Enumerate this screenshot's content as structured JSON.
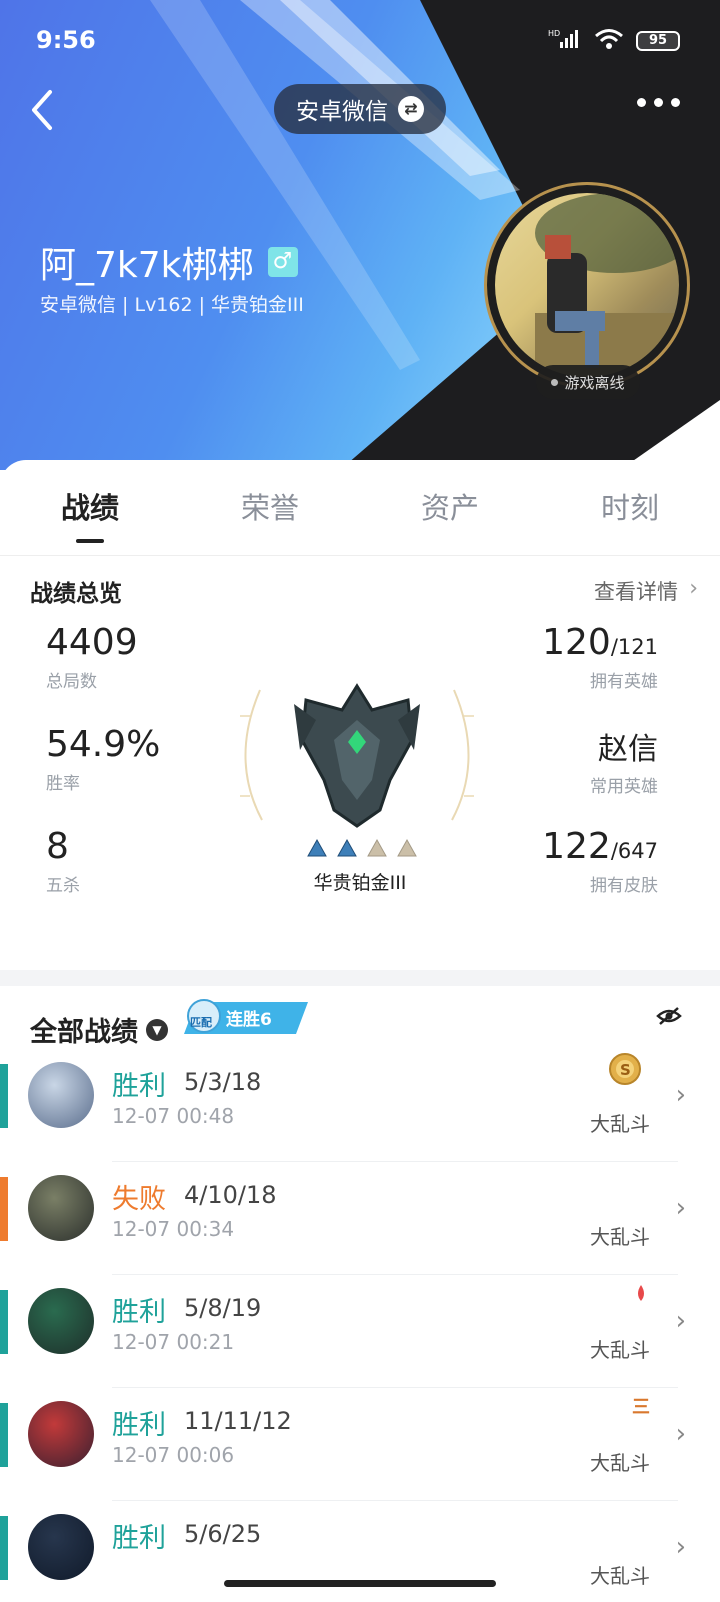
{
  "status_bar": {
    "time": "9:56",
    "battery": "95",
    "network": "HD"
  },
  "header": {
    "account_label": "安卓微信",
    "nickname": "阿_7k7k梆梆",
    "gender_symbol": "♂",
    "subinfo": "安卓微信 | Lv162 | 华贵铂金III",
    "offline_label": "游戏离线"
  },
  "tabs": [
    {
      "label": "战绩",
      "active": true
    },
    {
      "label": "荣誉",
      "active": false
    },
    {
      "label": "资产",
      "active": false
    },
    {
      "label": "时刻",
      "active": false
    }
  ],
  "overview": {
    "title": "战绩总览",
    "detail_link": "查看详情",
    "total_games": {
      "value": "4409",
      "label": "总局数"
    },
    "win_rate": {
      "value": "54.9%",
      "label": "胜率"
    },
    "penta_kills": {
      "value": "8",
      "label": "五杀"
    },
    "heroes_owned": {
      "value": "120",
      "total": "/121",
      "label": "拥有英雄"
    },
    "common_hero": {
      "value": "赵信",
      "label": "常用英雄"
    },
    "skins_owned": {
      "value": "122",
      "total": "/647",
      "label": "拥有皮肤"
    },
    "rank": {
      "name": "华贵铂金III",
      "stars_filled": 2,
      "stars_total": 4
    }
  },
  "matches_section": {
    "title": "全部战绩",
    "streak_mode": "匹配",
    "streak_label": "连胜6"
  },
  "matches": [
    {
      "result": "胜利",
      "kda": "5/3/18",
      "time": "12-07 00:48",
      "mode": "大乱斗",
      "outcome": "win",
      "badge": "S"
    },
    {
      "result": "失败",
      "kda": "4/10/18",
      "time": "12-07 00:34",
      "mode": "大乱斗",
      "outcome": "loss",
      "badge": ""
    },
    {
      "result": "胜利",
      "kda": "5/8/19",
      "time": "12-07 00:21",
      "mode": "大乱斗",
      "outcome": "win",
      "badge": "blood"
    },
    {
      "result": "胜利",
      "kda": "11/11/12",
      "time": "12-07 00:06",
      "mode": "大乱斗",
      "outcome": "win",
      "badge": "三"
    },
    {
      "result": "胜利",
      "kda": "5/6/25",
      "time": "",
      "mode": "大乱斗",
      "outcome": "win",
      "badge": ""
    }
  ],
  "colors": {
    "win": "#1fa29a",
    "loss": "#ee7b2e",
    "rank_gold": "#b7924e"
  }
}
